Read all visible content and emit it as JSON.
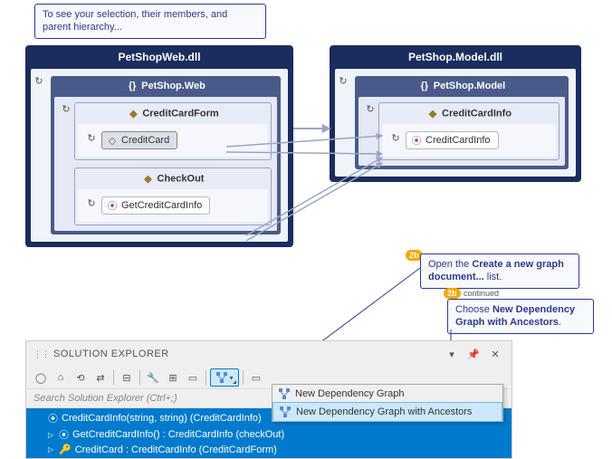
{
  "tooltip_top": "To see your selection, their members, and parent hierarchy...",
  "graph": {
    "left_dll": "PetShopWeb.dll",
    "left_ns": "PetShop.Web",
    "left_class1": "CreditCardForm",
    "left_member1": "CreditCard",
    "left_class2": "CheckOut",
    "left_member2": "GetCreditCardInfo",
    "right_dll": "PetShop.Model.dll",
    "right_ns": "PetShop.Model",
    "right_class": "CreditCardInfo",
    "right_member": "CreditCardInfo"
  },
  "callout1": {
    "badge": "2b",
    "text1": "Open the ",
    "bold": "Create a new graph document...",
    "text2": " list."
  },
  "callout2": {
    "badge": "2b",
    "cont": "continued",
    "text1": "Choose ",
    "bold": "New Dependency Graph with Ancestors",
    "text2": "."
  },
  "panel": {
    "title": "SOLUTION EXPLORER",
    "search_placeholder": "Search Solution Explorer (Ctrl+;)",
    "items": [
      "CreditCardInfo(string, string) (CreditCardInfo)",
      "GetCreditCardInfo() : CreditCardInfo (checkOut)",
      "CreditCard : CreditCardInfo (CreditCardForm)"
    ]
  },
  "menu": {
    "item1": "New Dependency Graph",
    "item2": "New Dependency Graph with Ancestors"
  },
  "icons": {
    "ns": "{}",
    "class": "◆",
    "field": "◇",
    "method": "⦿",
    "refresh": "↻"
  }
}
